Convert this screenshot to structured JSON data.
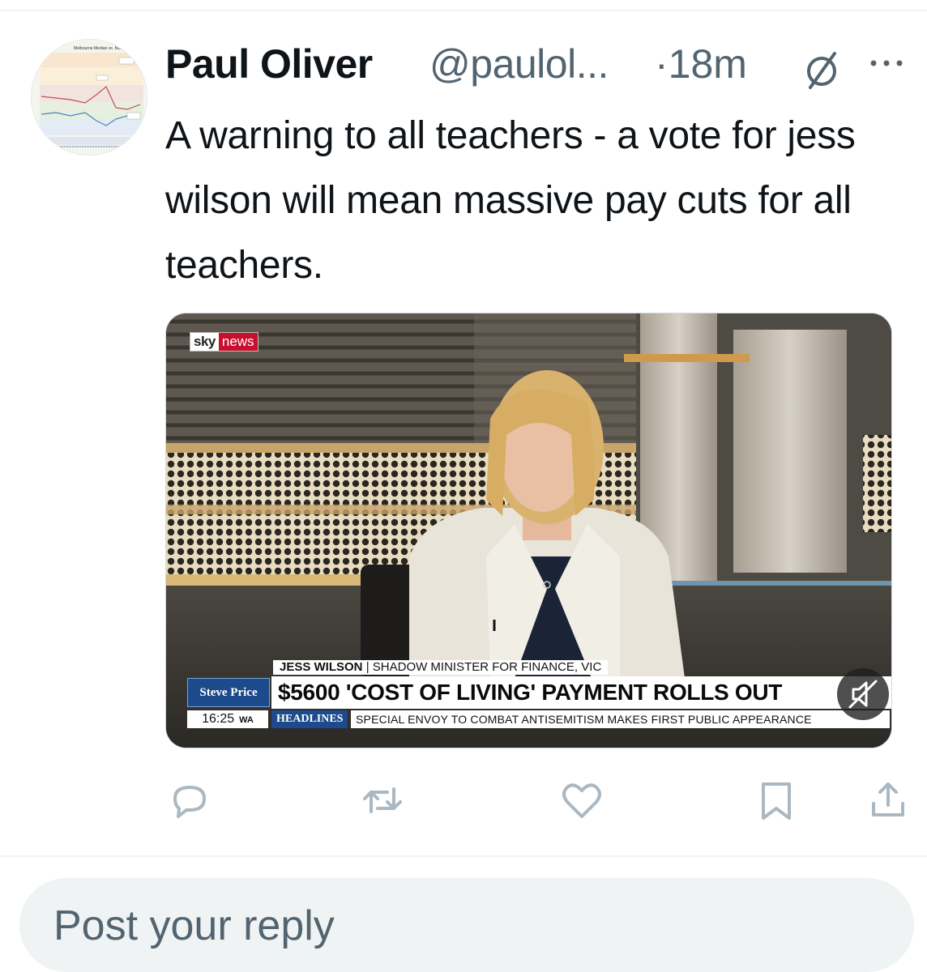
{
  "tweet": {
    "display_name": "Paul Oliver",
    "handle": "@paulol...",
    "separator": "·",
    "time": "18m",
    "edit_icon": "edited-slash-icon",
    "more_icon": "more-dots-icon",
    "text": "A warning to all teachers - a vote for jess wilson will mean massive pay cuts for all teachers."
  },
  "avatar": {
    "chart_title": "Melbourne Median vs. Bala..."
  },
  "media": {
    "logo_sky": "sky",
    "logo_news": "news",
    "name_strip_name": "JESS WILSON",
    "name_strip_role": " | SHADOW MINISTER FOR FINANCE, VIC",
    "host": "Steve Price",
    "headline": "$5600 'COST OF LIVING' PAYMENT ROLLS OUT",
    "clock": "16:25",
    "timezone": "WA",
    "ticker_label": "HEADLINES",
    "ticker_text": "SPECIAL ENVOY TO COMBAT ANTISEMITISM MAKES FIRST PUBLIC APPEARANCE",
    "mute_icon": "muted-speaker-icon"
  },
  "actions": [
    {
      "name": "reply",
      "icon": "reply-bubble-icon"
    },
    {
      "name": "repost",
      "icon": "repost-icon"
    },
    {
      "name": "like",
      "icon": "heart-icon"
    },
    {
      "name": "bookmark",
      "icon": "bookmark-icon"
    },
    {
      "name": "share",
      "icon": "share-icon"
    }
  ],
  "reply": {
    "placeholder": "Post your reply"
  },
  "colors": {
    "text_primary": "#0f1419",
    "text_secondary": "#536471",
    "divider": "#eff3f4",
    "action_icon": "#aab8c2",
    "sky_red": "#c8102e",
    "broadcast_blue": "#1c4a8c"
  }
}
